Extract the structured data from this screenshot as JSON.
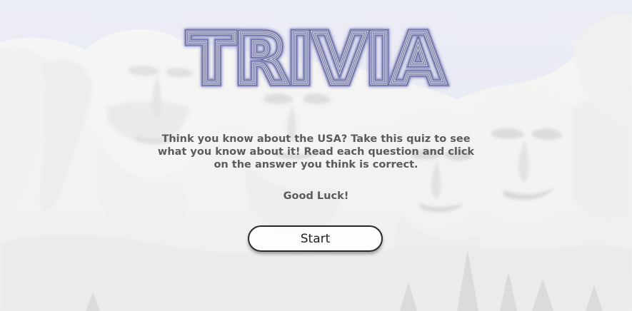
{
  "page": {
    "title": "TRIVIA",
    "intro": "Think you know about the USA? Take this quiz to see what you know about it! Read each question and click on the answer you think is correct.",
    "closing": "Good Luck!",
    "start_label": "Start"
  },
  "colors": {
    "sky": "#dfe3f0",
    "title_stroke": "#6a6e96",
    "text": "#5b5b5b",
    "button_border": "#2a2a2a"
  }
}
